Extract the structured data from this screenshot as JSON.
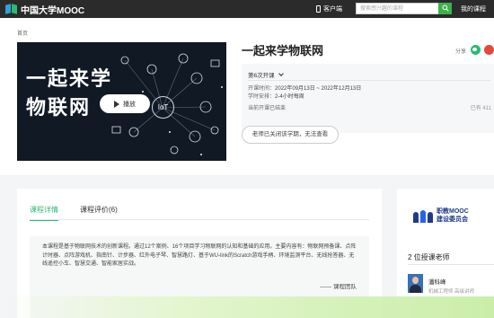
{
  "header": {
    "logo_text": "中国大学MOOC",
    "app_label": "客户端",
    "search_placeholder": "搜索感兴趣的课程",
    "my_course_label": "我的课程"
  },
  "breadcrumb": "首页",
  "cover": {
    "title_line1": "一起来学",
    "title_line2": "物联网",
    "play_label": "播放",
    "hub_label": "IoT"
  },
  "course": {
    "title": "一起来学物联网",
    "share_label": "分享",
    "term_label": "第6次开课",
    "time_label": "开课时间：",
    "time_value": "2022年09月13日 ~ 2022年12月13日",
    "effort_label": "学时安排：",
    "effort_value": "2-4小时每周",
    "status": "当前开课已结束",
    "enrolled": "已有 411",
    "closed_button": "老师已关闭该学期，无法查看"
  },
  "tabs": [
    {
      "label": "课程详情",
      "active": true
    },
    {
      "label": "课程评价(6)",
      "active": false
    }
  ],
  "description": {
    "text": "本课程是基于物联网技术的创新课程。通过12个案例、16个项目学习物联网的认知和基础的应用。主要内容有：物联网预备课、点阵计时器、点阵游戏机、指南针、计步器、红外电子琴、智慧路灯、基于WU-link的Scratch游戏手柄、环境监测平台、无线抢答器、无线遥控小车、智慧交通、智能家居实战。",
    "signature": "—— 课程团队"
  },
  "sidebar": {
    "org_line1": "职教MOOC",
    "org_line2": "建设委员会",
    "teachers_heading": "2 位授课老师",
    "teacher_name": "潘科峰",
    "teacher_title": "机械工程师 高级讲师"
  },
  "colors": {
    "accent": "#2dba73",
    "topbar": "#2b2b2b",
    "search_button": "#3bb34a"
  }
}
